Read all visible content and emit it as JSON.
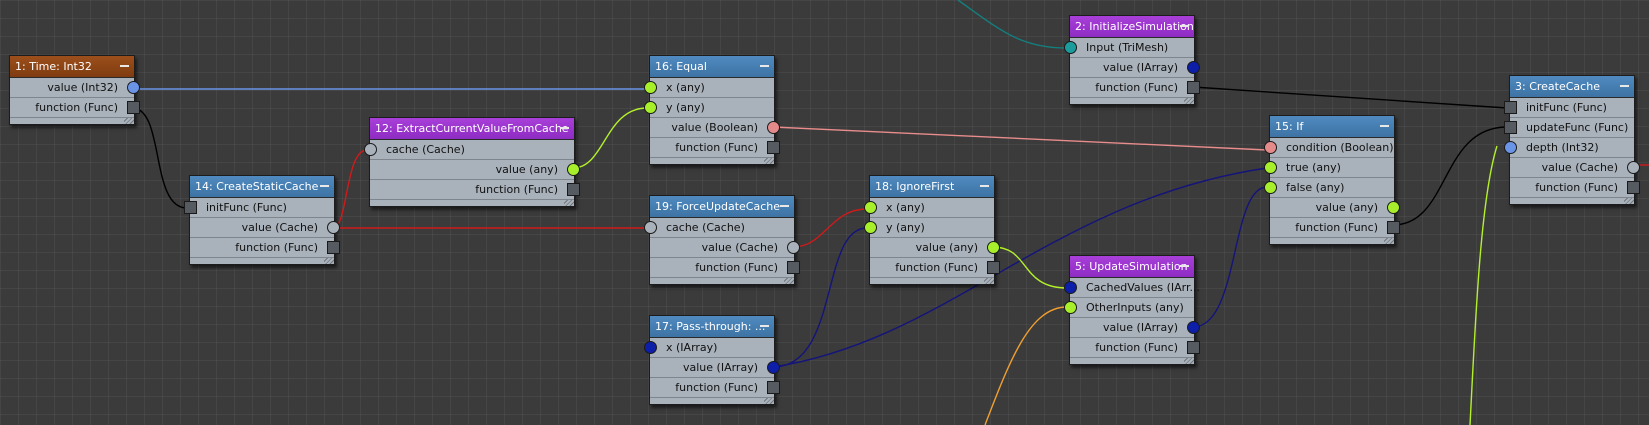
{
  "colors": {
    "background": "#3b3b3b",
    "node_body": "#a9b1ba",
    "header_blue": "#3e73a4",
    "header_purple": "#8e2cc2",
    "header_orange": "#7f3c10"
  },
  "nodes": {
    "n1": {
      "title": "1: Time: Int32",
      "rows": [
        "value (Int32)",
        "function (Func)"
      ]
    },
    "n2": {
      "title": "2: InitializeSimulation",
      "rows": [
        "Input (TriMesh)",
        "value (IArray)",
        "function (Func)"
      ]
    },
    "n3": {
      "title": "3: CreateCache",
      "rows": [
        "initFunc (Func)",
        "updateFunc (Func)",
        "depth (Int32)",
        "value (Cache)",
        "function (Func)"
      ]
    },
    "n5": {
      "title": "5: UpdateSimulation",
      "rows": [
        "CachedValues (IArr...",
        "OtherInputs (any)",
        "value (IArray)",
        "function (Func)"
      ]
    },
    "n12": {
      "title": "12: ExtractCurrentValueFromCache",
      "rows": [
        "cache (Cache)",
        "value (any)",
        "function (Func)"
      ]
    },
    "n14": {
      "title": "14: CreateStaticCache",
      "rows": [
        "initFunc (Func)",
        "value (Cache)",
        "function (Func)"
      ]
    },
    "n15": {
      "title": "15: If",
      "rows": [
        "condition (Boolean)",
        "true (any)",
        "false (any)",
        "value (any)",
        "function (Func)"
      ]
    },
    "n16": {
      "title": "16: Equal",
      "rows": [
        "x (any)",
        "y (any)",
        "value (Boolean)",
        "function (Func)"
      ]
    },
    "n17": {
      "title": "17: Pass-through: ...",
      "rows": [
        "x (IArray)",
        "value (IArray)",
        "function (Func)"
      ]
    },
    "n18": {
      "title": "18: IgnoreFirst",
      "rows": [
        "x (any)",
        "y (any)",
        "value (any)",
        "function (Func)"
      ]
    },
    "n19": {
      "title": "19: ForceUpdateCache",
      "rows": [
        "cache (Cache)",
        "value (Cache)",
        "function (Func)"
      ]
    }
  },
  "wire_colors": {
    "int": "#6a94e6",
    "func": "#000000",
    "cache": "#d01a1a",
    "any": "#b4f02a",
    "boolean": "#e88c8c",
    "iarray": "#14147a",
    "trimesh": "#137f7f",
    "orange": "#f0a030"
  }
}
